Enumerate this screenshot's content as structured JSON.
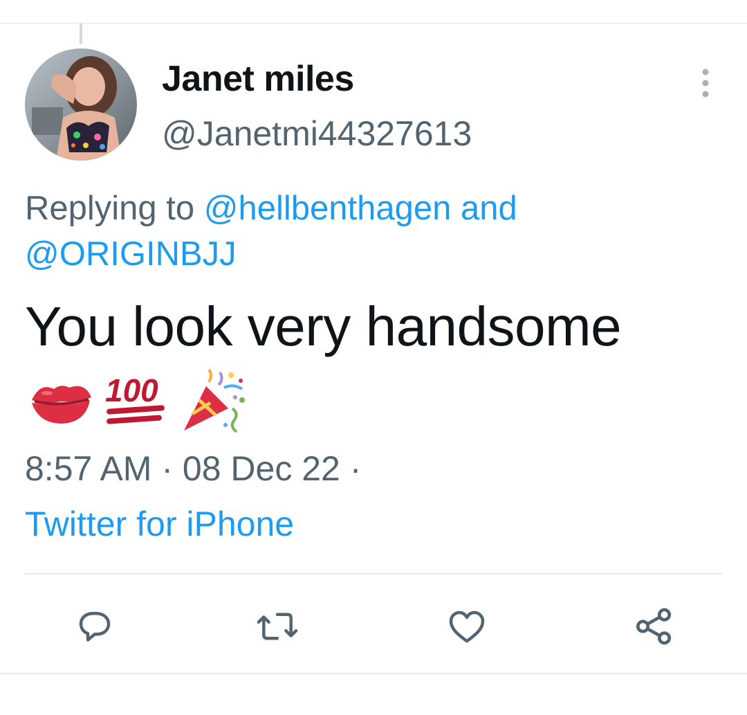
{
  "tweet": {
    "author": {
      "display_name": "Janet miles",
      "handle": "@Janetmi44327613"
    },
    "reply_context": {
      "prefix": "Replying to ",
      "mention_1": "@hellbenthagen",
      "joiner": " and",
      "mention_2": "@ORIGINBJJ"
    },
    "text": "You look very handsome",
    "emojis": [
      "kiss-mark-emoji",
      "hundred-points-emoji",
      "party-popper-emoji"
    ],
    "time": "8:57 AM",
    "separator_1": "·",
    "date": "08 Dec 22",
    "separator_2": "·",
    "source": "Twitter for iPhone"
  },
  "actions": [
    {
      "name": "reply",
      "icon": "reply-bubble-icon"
    },
    {
      "name": "retweet",
      "icon": "retweet-icon"
    },
    {
      "name": "like",
      "icon": "heart-icon"
    },
    {
      "name": "share",
      "icon": "share-icon"
    }
  ],
  "colors": {
    "accent": "#1d9bf0",
    "secondary_text": "#536471",
    "primary_text": "#0f1419",
    "divider": "#e8ebed"
  }
}
